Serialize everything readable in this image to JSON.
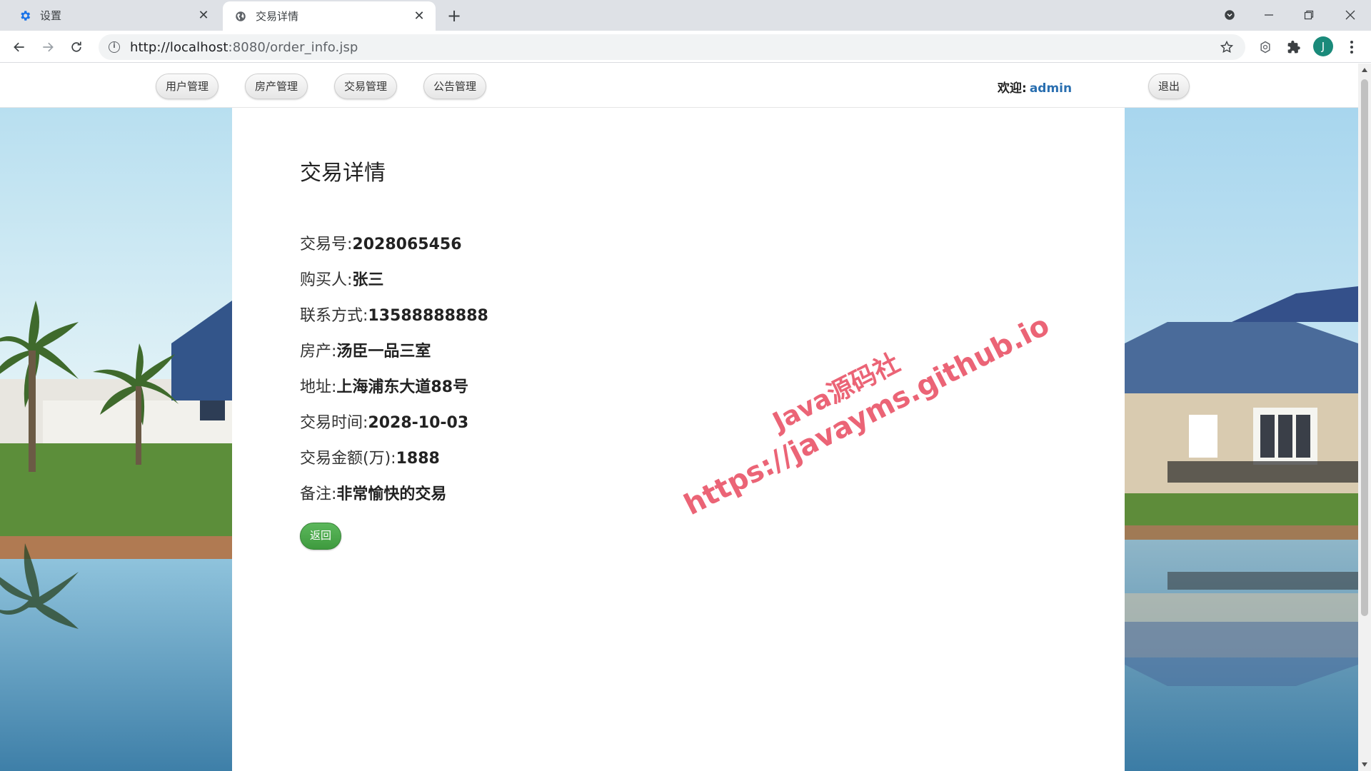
{
  "browser": {
    "tabs": [
      {
        "label": "设置",
        "icon": "gear-icon",
        "close": "✕"
      },
      {
        "label": "交易详情",
        "icon": "globe-icon",
        "close": "✕"
      }
    ],
    "new_tab": "+",
    "url_host": "http://localhost",
    "url_rest": ":8080/order_info.jsp",
    "profile_initial": "J"
  },
  "nav": {
    "items": [
      "用户管理",
      "房产管理",
      "交易管理",
      "公告管理"
    ],
    "welcome_label": "欢迎:",
    "username": "admin",
    "logout": "退出"
  },
  "detail": {
    "title": "交易详情",
    "fields": [
      {
        "label": "交易号:",
        "value": "2028065456"
      },
      {
        "label": "购买人:",
        "value": "张三"
      },
      {
        "label": "联系方式:",
        "value": "13588888888"
      },
      {
        "label": "房产:",
        "value": "汤臣一品三室"
      },
      {
        "label": "地址:",
        "value": "上海浦东大道88号"
      },
      {
        "label": "交易时间:",
        "value": "2028-10-03"
      },
      {
        "label": "交易金额(万):",
        "value": "1888"
      },
      {
        "label": "备注:",
        "value": "非常愉快的交易"
      }
    ],
    "back_button": "返回"
  },
  "watermark": {
    "line1": "Java源码社",
    "line2": "https://javayms.github.io"
  },
  "colors": {
    "accent_link": "#2a6fb0",
    "back_button": "#4cae4c",
    "watermark": "#e84a5f"
  }
}
